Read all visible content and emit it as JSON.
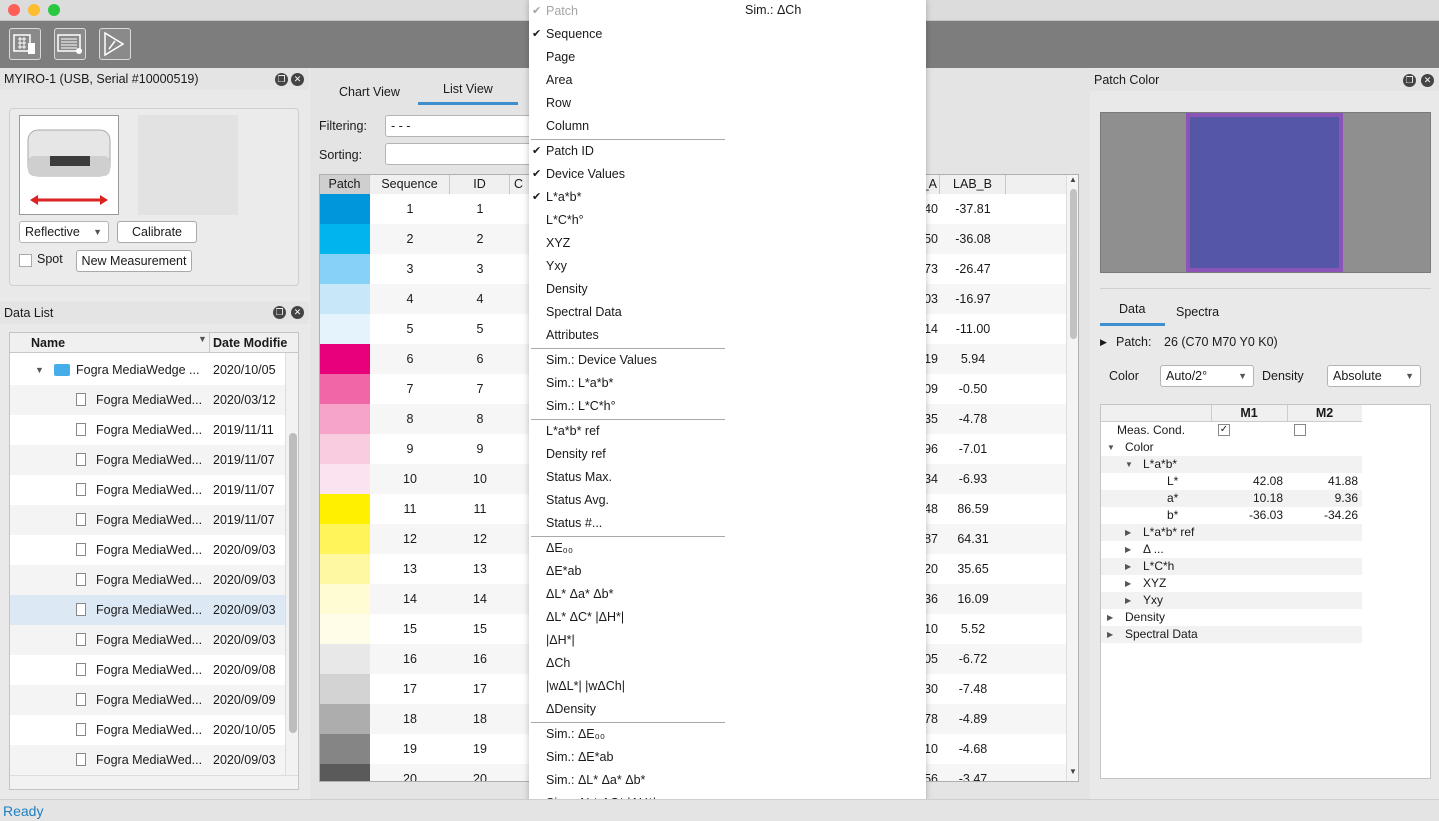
{
  "app": {
    "status": "Ready",
    "toolbar": {
      "icons": [
        "measure-chart-icon",
        "list-view-icon",
        "play-sequence-icon"
      ]
    }
  },
  "device_panel": {
    "title": "MYIRO-1 (USB, Serial #10000519)",
    "mode": "Reflective",
    "calibrate_label": "Calibrate",
    "spot_label": "Spot",
    "new_measurement_label": "New Measurement"
  },
  "data_list": {
    "title": "Data List",
    "col_name": "Name",
    "col_date": "Date Modifie",
    "folder": {
      "name": "Fogra MediaWedge ...",
      "date": "2020/10/05"
    },
    "items": [
      {
        "name": "Fogra MediaWed...",
        "date": "2020/03/12"
      },
      {
        "name": "Fogra MediaWed...",
        "date": "2019/11/11"
      },
      {
        "name": "Fogra MediaWed...",
        "date": "2019/11/07"
      },
      {
        "name": "Fogra MediaWed...",
        "date": "2019/11/07"
      },
      {
        "name": "Fogra MediaWed...",
        "date": "2019/11/07"
      },
      {
        "name": "Fogra MediaWed...",
        "date": "2020/09/03"
      },
      {
        "name": "Fogra MediaWed...",
        "date": "2020/09/03"
      },
      {
        "name": "Fogra MediaWed...",
        "date": "2020/09/03"
      },
      {
        "name": "Fogra MediaWed...",
        "date": "2020/09/03"
      },
      {
        "name": "Fogra MediaWed...",
        "date": "2020/09/08"
      },
      {
        "name": "Fogra MediaWed...",
        "date": "2020/09/09"
      },
      {
        "name": "Fogra MediaWed...",
        "date": "2020/10/05"
      },
      {
        "name": "Fogra MediaWed...",
        "date": "2020/09/03"
      }
    ]
  },
  "list_view": {
    "tabs": [
      "Chart View",
      "List View"
    ],
    "filtering_label": "Filtering:",
    "filtering_value": "- - -",
    "sorting_label": "Sorting:",
    "sorting_value": "",
    "partial_right_label": ")",
    "columns": [
      "Patch",
      "Sequence",
      "ID",
      "C",
      "_A",
      "LAB_B"
    ],
    "rows": [
      {
        "seq": "1",
        "id": "1",
        "a": "40",
        "b": "-37.81",
        "color": "#0096dc"
      },
      {
        "seq": "2",
        "id": "2",
        "a": "50",
        "b": "-36.08",
        "color": "#00b5ee"
      },
      {
        "seq": "3",
        "id": "3",
        "a": "73",
        "b": "-26.47",
        "color": "#86d2f6"
      },
      {
        "seq": "4",
        "id": "4",
        "a": "03",
        "b": "-16.97",
        "color": "#c8e8fa"
      },
      {
        "seq": "5",
        "id": "5",
        "a": "14",
        "b": "-11.00",
        "color": "#e4f3fc"
      },
      {
        "seq": "6",
        "id": "6",
        "a": "19",
        "b": "5.94",
        "color": "#e8007a"
      },
      {
        "seq": "7",
        "id": "7",
        "a": "09",
        "b": "-0.50",
        "color": "#f066a6"
      },
      {
        "seq": "8",
        "id": "8",
        "a": "35",
        "b": "-4.78",
        "color": "#f6a4c8"
      },
      {
        "seq": "9",
        "id": "9",
        "a": "96",
        "b": "-7.01",
        "color": "#f9cce0"
      },
      {
        "seq": "10",
        "id": "10",
        "a": "34",
        "b": "-6.93",
        "color": "#fbe4ef"
      },
      {
        "seq": "11",
        "id": "11",
        "a": "48",
        "b": "86.59",
        "color": "#fff000"
      },
      {
        "seq": "12",
        "id": "12",
        "a": "87",
        "b": "64.31",
        "color": "#fff45a"
      },
      {
        "seq": "13",
        "id": "13",
        "a": "20",
        "b": "35.65",
        "color": "#fff8a3"
      },
      {
        "seq": "14",
        "id": "14",
        "a": "36",
        "b": "16.09",
        "color": "#fffbd2"
      },
      {
        "seq": "15",
        "id": "15",
        "a": "10",
        "b": "5.52",
        "color": "#fffde8"
      },
      {
        "seq": "16",
        "id": "16",
        "a": "05",
        "b": "-6.72",
        "color": "#e8e8e8"
      },
      {
        "seq": "17",
        "id": "17",
        "a": "30",
        "b": "-7.48",
        "color": "#d3d3d3"
      },
      {
        "seq": "18",
        "id": "18",
        "a": "78",
        "b": "-4.89",
        "color": "#adadad"
      },
      {
        "seq": "19",
        "id": "19",
        "a": "10",
        "b": "-4.68",
        "color": "#858585"
      },
      {
        "seq": "20",
        "id": "20",
        "a": "56",
        "b": "-3.47",
        "color": "#5a5a5a"
      }
    ]
  },
  "menu": {
    "right_header": "Sim.: ΔCh",
    "groups": [
      [
        {
          "label": "Patch",
          "checked": true,
          "disabled": true
        },
        {
          "label": "Sequence",
          "checked": true
        },
        {
          "label": "Page"
        },
        {
          "label": "Area"
        },
        {
          "label": "Row"
        },
        {
          "label": "Column"
        }
      ],
      [
        {
          "label": "Patch ID",
          "checked": true
        },
        {
          "label": "Device Values",
          "checked": true
        },
        {
          "label": "L*a*b*",
          "checked": true
        },
        {
          "label": "L*C*h°"
        },
        {
          "label": "XYZ"
        },
        {
          "label": "Yxy"
        },
        {
          "label": "Density"
        },
        {
          "label": "Spectral Data"
        },
        {
          "label": "Attributes"
        }
      ],
      [
        {
          "label": "Sim.: Device Values"
        },
        {
          "label": "Sim.: L*a*b*"
        },
        {
          "label": "Sim.: L*C*h°"
        }
      ],
      [
        {
          "label": "L*a*b* ref"
        },
        {
          "label": "Density ref"
        },
        {
          "label": "Status Max."
        },
        {
          "label": "Status Avg."
        },
        {
          "label": "Status #..."
        }
      ],
      [
        {
          "label": "ΔE₀₀"
        },
        {
          "label": "ΔE*ab"
        },
        {
          "label": "ΔL* Δa* Δb*"
        },
        {
          "label": "ΔL* ΔC* |ΔH*|"
        },
        {
          "label": "|ΔH*|"
        },
        {
          "label": "ΔCh"
        },
        {
          "label": "|wΔL*| |wΔCh|"
        },
        {
          "label": "ΔDensity"
        }
      ],
      [
        {
          "label": "Sim.: ΔE₀₀"
        },
        {
          "label": "Sim.: ΔE*ab"
        },
        {
          "label": "Sim.: ΔL* Δa* Δb*"
        },
        {
          "label": "Sim.: ΔL* ΔC* |ΔH*|"
        }
      ]
    ]
  },
  "patch_color": {
    "title": "Patch Color",
    "swatch_color": "#5656a6",
    "swatch_border": "#8a55b6",
    "tabs": [
      "Data",
      "Spectra"
    ],
    "patch_label": "Patch:",
    "patch_value": "26 (C70 M70 Y0 K0)",
    "color_label": "Color",
    "color_value": "Auto/2°",
    "density_label": "Density",
    "density_value": "Absolute",
    "col_m1": "M1",
    "col_m2": "M2",
    "meas_cond": "Meas. Cond.",
    "rows": [
      {
        "label": "Color",
        "indent": 0,
        "tri": "down"
      },
      {
        "label": "L*a*b*",
        "indent": 1,
        "tri": "down"
      },
      {
        "label": "L*",
        "indent": 2,
        "m1": "42.08",
        "m2": "41.88"
      },
      {
        "label": "a*",
        "indent": 2,
        "m1": "10.18",
        "m2": "9.36"
      },
      {
        "label": "b*",
        "indent": 2,
        "m1": "-36.03",
        "m2": "-34.26"
      },
      {
        "label": "L*a*b* ref",
        "indent": 1,
        "tri": "right"
      },
      {
        "label": "Δ ...",
        "indent": 1,
        "tri": "right"
      },
      {
        "label": "L*C*h",
        "indent": 1,
        "tri": "right"
      },
      {
        "label": "XYZ",
        "indent": 1,
        "tri": "right"
      },
      {
        "label": "Yxy",
        "indent": 1,
        "tri": "right"
      },
      {
        "label": "Density",
        "indent": 0,
        "tri": "right"
      },
      {
        "label": "Spectral Data",
        "indent": 0,
        "tri": "right"
      }
    ]
  }
}
